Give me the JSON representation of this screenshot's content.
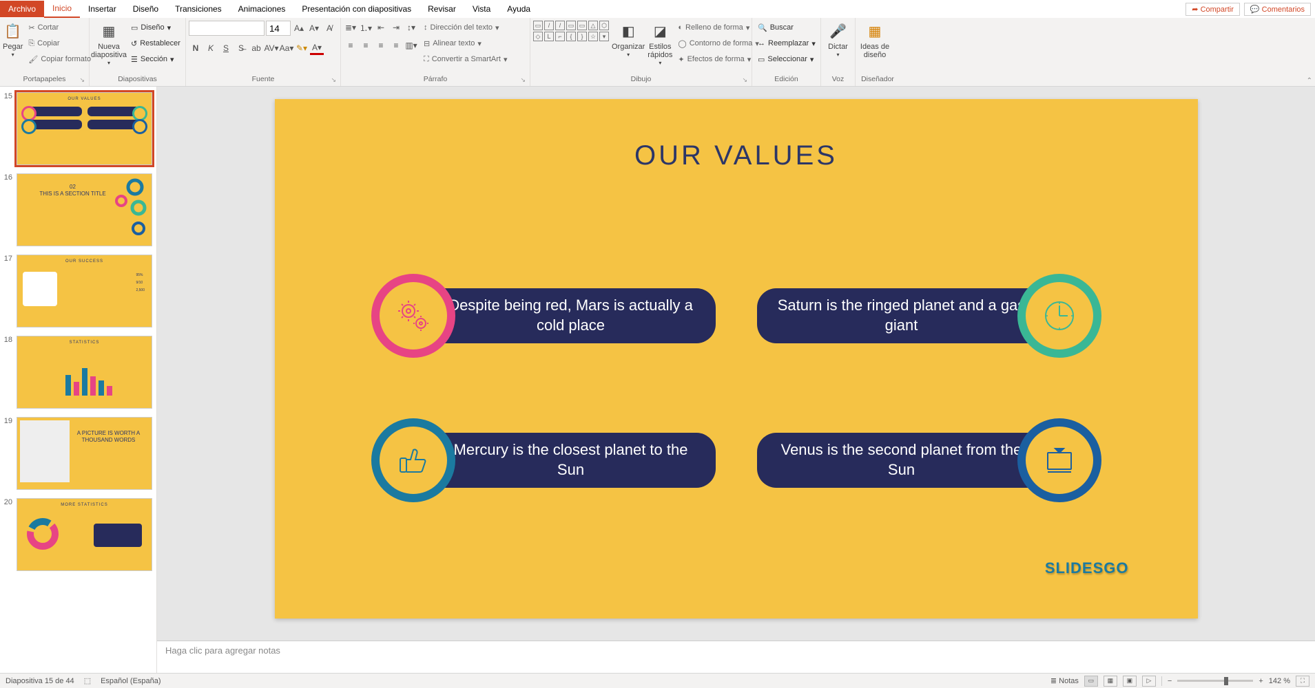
{
  "tabs": {
    "file": "Archivo",
    "home": "Inicio",
    "insert": "Insertar",
    "design": "Diseño",
    "trans": "Transiciones",
    "anim": "Animaciones",
    "slideShow": "Presentación con diapositivas",
    "review": "Revisar",
    "view": "Vista",
    "help": "Ayuda"
  },
  "topRight": {
    "share": "Compartir",
    "comments": "Comentarios"
  },
  "clipboard": {
    "paste": "Pegar",
    "cut": "Cortar",
    "copy": "Copiar",
    "format": "Copiar formato",
    "label": "Portapapeles"
  },
  "slides": {
    "new": "Nueva diapositiva",
    "layout": "Diseño",
    "reset": "Restablecer",
    "section": "Sección",
    "label": "Diapositivas"
  },
  "font": {
    "size": "14",
    "label": "Fuente"
  },
  "paragraph": {
    "dir": "Dirección del texto",
    "align": "Alinear texto",
    "smart": "Convertir a SmartArt",
    "label": "Párrafo"
  },
  "drawing": {
    "arrange": "Organizar",
    "quick": "Estilos rápidos",
    "fill": "Relleno de forma",
    "outline": "Contorno de forma",
    "effects": "Efectos de forma",
    "label": "Dibujo"
  },
  "editing": {
    "find": "Buscar",
    "replace": "Reemplazar",
    "select": "Seleccionar",
    "label": "Edición"
  },
  "voice": {
    "dictate": "Dictar",
    "label": "Voz"
  },
  "designer": {
    "ideas": "Ideas de diseño",
    "label": "Diseñador"
  },
  "slide": {
    "title": "OUR VALUES",
    "c1": "Despite being red, Mars is actually a cold place",
    "c2": "Saturn is the ringed planet and a gas giant",
    "c3": "Mercury is the closest planet to the Sun",
    "c4": "Venus is the second planet from the Sun",
    "brand": "SLIDESGO"
  },
  "thumbs": {
    "n15": "15",
    "n16": "16",
    "n17": "17",
    "n18": "18",
    "n19": "19",
    "n20": "20",
    "t16a": "02",
    "t16b": "THIS IS A SECTION TITLE",
    "t17": "OUR SUCCESS",
    "t18": "STATISTICS",
    "t20": "MORE STATISTICS",
    "t19": "A PICTURE IS WORTH A THOUSAND WORDS"
  },
  "notes": {
    "placeholder": "Haga clic para agregar notas"
  },
  "status": {
    "slide": "Diapositiva 15 de 44",
    "lang": "Español (España)",
    "notes": "Notas",
    "zoom": "142 %"
  }
}
